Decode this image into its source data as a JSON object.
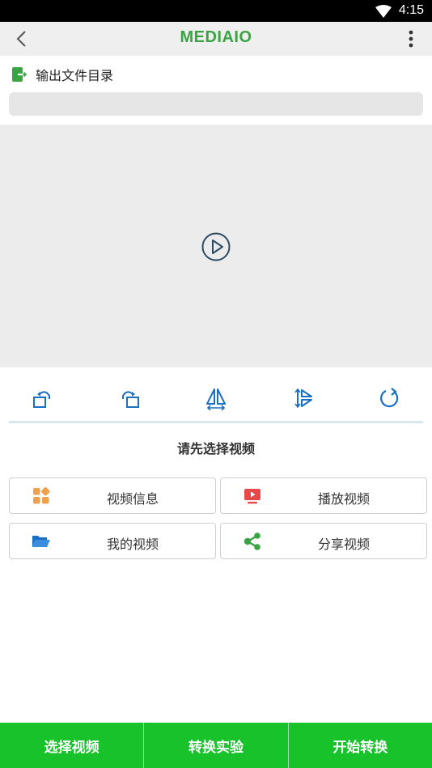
{
  "status_bar": {
    "time": "4:15"
  },
  "app_bar": {
    "title": "MEDIAIO"
  },
  "output": {
    "label": "输出文件目录",
    "path": ""
  },
  "hint": "请先选择视频",
  "actions": [
    {
      "label": "视频信息",
      "icon": "apps-icon"
    },
    {
      "label": "播放视频",
      "icon": "play-tv-icon"
    },
    {
      "label": "我的视频",
      "icon": "folder-icon"
    },
    {
      "label": "分享视频",
      "icon": "share-icon"
    }
  ],
  "tools": [
    "rotate-left-icon",
    "rotate-right-icon",
    "flip-horizontal-icon",
    "flip-vertical-icon",
    "reset-icon"
  ],
  "bottom": {
    "select": "选择视频",
    "lab": "转换实验",
    "start": "开始转换"
  },
  "colors": {
    "brand_green": "#3aa342",
    "bottom_green": "#18c22a",
    "tool_blue": "#1a6fc4"
  }
}
